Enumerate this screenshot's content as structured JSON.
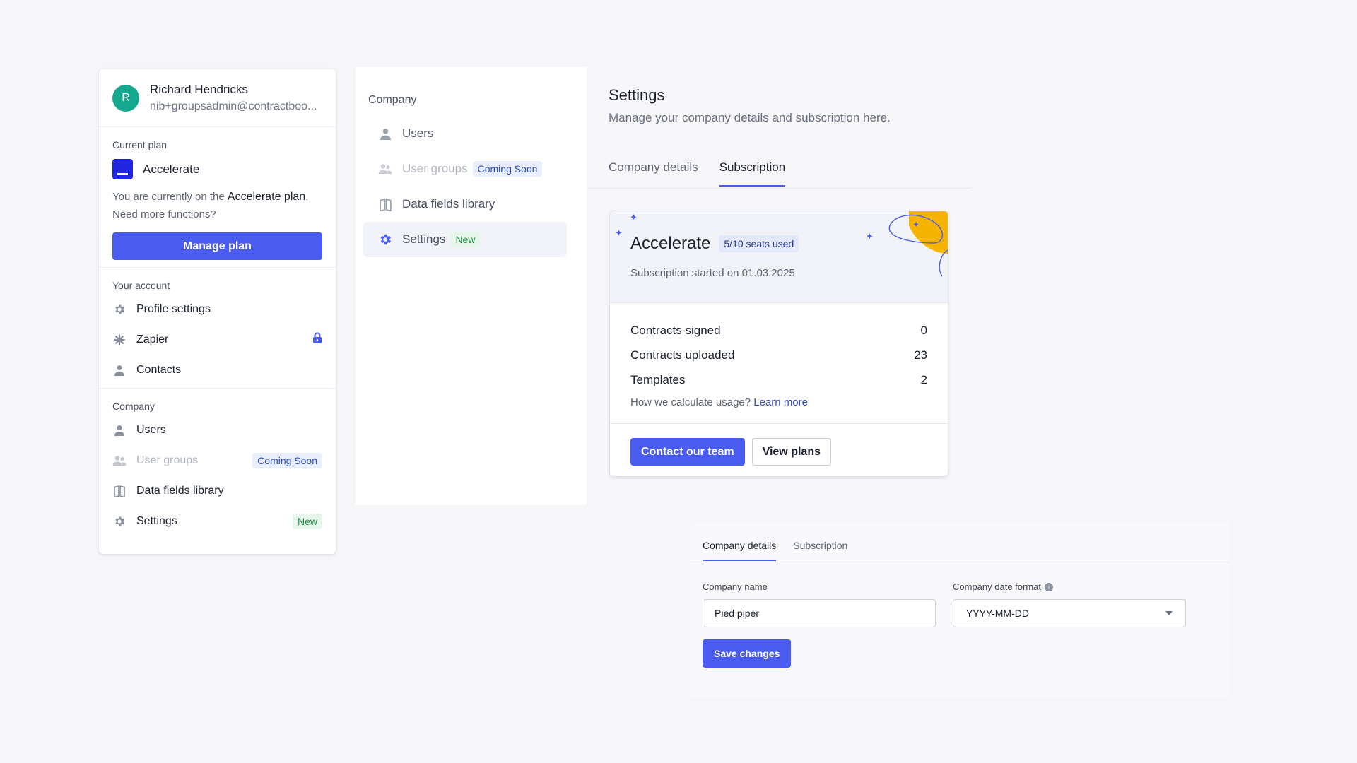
{
  "account": {
    "avatar_initial": "R",
    "name": "Richard Hendricks",
    "email": "nib+groupsadmin@contractboo...",
    "current_plan_title": "Current plan",
    "plan_name": "Accelerate",
    "plan_desc_prefix": "You are currently on the ",
    "plan_desc_strong": "Accelerate plan",
    "plan_desc_suffix": ".",
    "plan_desc_line2": "Need more functions?",
    "manage_button": "Manage plan",
    "your_account_title": "Your account",
    "account_items": [
      {
        "label": "Profile settings",
        "icon": "gear-icon"
      },
      {
        "label": "Zapier",
        "icon": "asterisk-icon",
        "locked": true
      },
      {
        "label": "Contacts",
        "icon": "person-icon"
      }
    ],
    "company_title": "Company",
    "company_items": [
      {
        "label": "Users",
        "icon": "person-icon"
      },
      {
        "label": "User groups",
        "icon": "group-icon",
        "badge": "Coming Soon",
        "disabled": true
      },
      {
        "label": "Data fields library",
        "icon": "book-icon"
      },
      {
        "label": "Settings",
        "icon": "gear-icon",
        "badge": "New"
      }
    ]
  },
  "nav": {
    "title": "Company",
    "items": [
      {
        "label": "Users",
        "icon": "person-icon"
      },
      {
        "label": "User groups",
        "icon": "group-icon",
        "badge": "Coming Soon",
        "disabled": true
      },
      {
        "label": "Data fields library",
        "icon": "book-icon"
      },
      {
        "label": "Settings",
        "icon": "gear-icon",
        "badge": "New",
        "active": true
      }
    ]
  },
  "settings": {
    "title": "Settings",
    "subtitle": "Manage your company details and subscription here.",
    "tabs": [
      {
        "label": "Company details",
        "active": false
      },
      {
        "label": "Subscription",
        "active": true
      }
    ],
    "subscription": {
      "plan_name": "Accelerate",
      "seats_badge": "5/10 seats used",
      "started": "Subscription started on 01.03.2025",
      "usage": [
        {
          "label": "Contracts signed",
          "value": "0"
        },
        {
          "label": "Contracts uploaded",
          "value": "23"
        },
        {
          "label": "Templates",
          "value": "2"
        }
      ],
      "help_text": "How we calculate usage?",
      "help_link": "Learn more",
      "contact_button": "Contact our team",
      "view_plans_button": "View plans"
    }
  },
  "company_form": {
    "tabs": [
      {
        "label": "Company details",
        "active": true
      },
      {
        "label": "Subscription",
        "active": false
      }
    ],
    "name_label": "Company name",
    "name_value": "Pied piper",
    "date_format_label": "Company date format",
    "date_format_value": "YYYY-MM-DD",
    "save_button": "Save changes"
  },
  "colors": {
    "accent": "#4a5cf0",
    "plan_icon": "#1f25e0",
    "avatar": "#14a88f",
    "badge_new": "#1e8a44",
    "badge_soon": "#2b4bbd",
    "decoration": "#f6b400"
  }
}
